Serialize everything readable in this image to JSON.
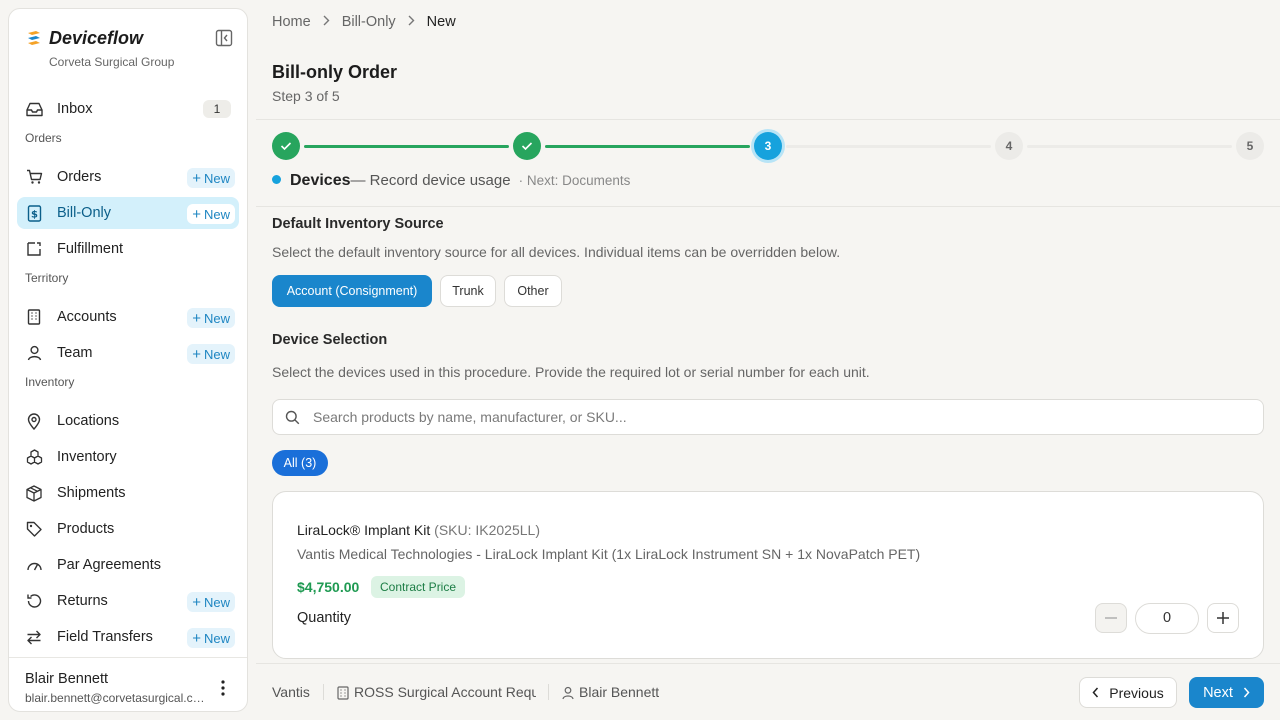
{
  "sidebar": {
    "brand": "Deviceflow",
    "org": "Corveta Surgical Group",
    "inbox": {
      "label": "Inbox",
      "count": "1"
    },
    "sections": {
      "orders": "Orders",
      "territory": "Territory",
      "inventory": "Inventory"
    },
    "items": {
      "orders": "Orders",
      "bill_only": "Bill-Only",
      "fulfillment": "Fulfillment",
      "accounts": "Accounts",
      "team": "Team",
      "locations": "Locations",
      "inventory": "Inventory",
      "shipments": "Shipments",
      "products": "Products",
      "par_agreements": "Par Agreements",
      "returns": "Returns",
      "field_transfers": "Field Transfers"
    },
    "new_label": "New",
    "user": {
      "name": "Blair Bennett",
      "email": "blair.bennett@corvetasurgical.com"
    }
  },
  "breadcrumb": {
    "home": "Home",
    "section": "Bill-Only",
    "current": "New"
  },
  "page": {
    "title": "Bill-only Order",
    "step": "Step 3 of 5"
  },
  "stepper": {
    "current_number": "3",
    "step4": "4",
    "step5": "5",
    "current_title": "Devices",
    "current_desc": "— Record device usage",
    "next": "· Next: Documents"
  },
  "inventory_source": {
    "title": "Default Inventory Source",
    "desc": "Select the default inventory source for all devices. Individual items can be overridden below.",
    "options": [
      "Account (Consignment)",
      "Trunk",
      "Other"
    ],
    "selected": "Account (Consignment)"
  },
  "device_selection": {
    "title": "Device Selection",
    "desc": "Select the devices used in this procedure. Provide the required lot or serial number for each unit.",
    "search_placeholder": "Search products by name, manufacturer, or SKU...",
    "filter_all": "All (3)"
  },
  "product": {
    "name": "LiraLock® Implant Kit",
    "sku": "(SKU: IK2025LL)",
    "desc": "Vantis Medical Technologies - LiraLock Implant Kit (1x LiraLock Instrument SN + 1x NovaPatch PET)",
    "price": "$4,750.00",
    "price_badge": "Contract Price",
    "qty_label": "Quantity",
    "qty": "0"
  },
  "footer": {
    "manufacturer": "Vantis",
    "account": "ROSS Surgical Account Request",
    "rep": "Blair Bennett",
    "prev": "Previous",
    "next": "Next"
  },
  "colors": {
    "accent": "#1a86cc",
    "done": "#27a55e",
    "current": "#16a2dd",
    "price": "#1f9a52"
  }
}
